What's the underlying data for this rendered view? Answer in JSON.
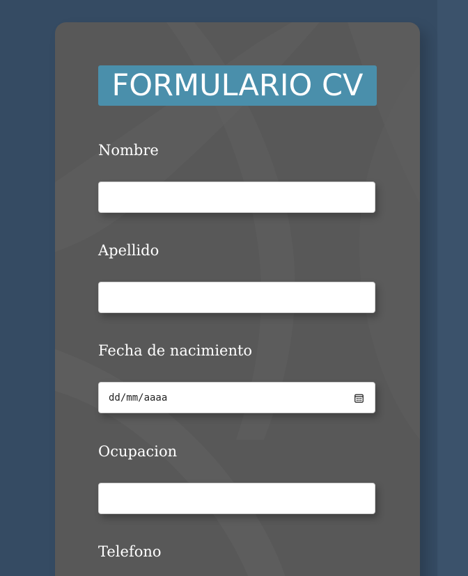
{
  "form": {
    "title": "FORMULARIO CV",
    "fields": [
      {
        "label": "Nombre",
        "value": ""
      },
      {
        "label": "Apellido",
        "value": ""
      },
      {
        "label": "Fecha de nacimiento",
        "placeholder": "dd/mm/aaaa"
      },
      {
        "label": "Ocupacion",
        "value": ""
      },
      {
        "label": "Telefono"
      }
    ]
  },
  "colors": {
    "page_background": "#354b63",
    "card_background": "#585858",
    "title_background": "#4a8fab",
    "text": "#ffffff"
  },
  "icons": {
    "date_picker": "calendar-icon"
  }
}
